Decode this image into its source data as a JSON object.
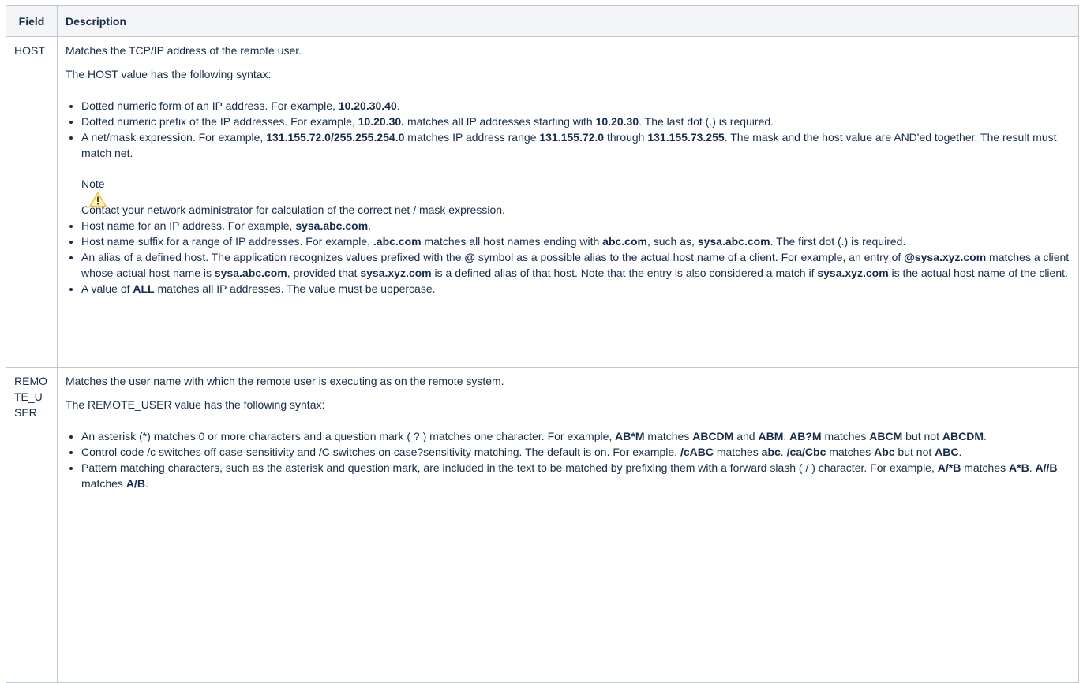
{
  "table": {
    "header": {
      "field": "Field",
      "description": "Description"
    },
    "rows": [
      {
        "field": "HOST",
        "intro": "Matches the TCP/IP address of the remote user.",
        "syntax": "The HOST value has the following syntax:",
        "items": [
          {
            "t1": "Dotted numeric form of an IP address. For example, ",
            "b1": "10.20.30.40",
            "t2": "."
          },
          {
            "t1": "Dotted numeric prefix of the IP addresses. For example, ",
            "b1": "10.20.30.",
            "t2": " matches all IP addresses starting with ",
            "b2": "10.20.30",
            "t3": ". The last dot (.) is required."
          },
          {
            "t1": "A net/mask expression. For example, ",
            "b1": "131.155.72.0/255.255.254.0",
            "t2": " matches IP address range ",
            "b2": "131.155.72.0",
            "t3": " through ",
            "b3": "131.155.73.255",
            "t4": ". The mask and the host value are AND'ed together. The result must match net."
          },
          {
            "t1": "Host name for an IP address. For example, ",
            "b1": "sysa.abc.com",
            "t2": "."
          },
          {
            "t1": "Host name suffix for a range of IP addresses. For example, ",
            "b1": ".abc.com",
            "t2": " matches all host names ending with ",
            "b2": "abc.com",
            "t3": ", such as, ",
            "b3": "sysa.abc.com",
            "t4": ". The first dot (.) is required."
          },
          {
            "t1": "An alias of a defined host. The application recognizes values prefixed with the ",
            "b1": "@",
            "t2": " symbol as a possible alias to the actual host name of a client. For example, an entry of ",
            "b2": "@sysa.xyz.com",
            "t3": " matches a client whose actual host name is ",
            "b3": "sysa.abc.com",
            "t4": ", provided that ",
            "b4": "sysa.xyz.com",
            "t5": " is a defined alias of that host. Note that the entry is also considered a match if ",
            "b5": "sysa.xyz.com",
            "t6": " is the actual host name of the client."
          },
          {
            "t1": "A value of ",
            "b1": "ALL",
            "t2": " matches all IP addresses. The value must be uppercase."
          }
        ],
        "note": {
          "title": "Note",
          "icon": "warning-icon",
          "body": "Contact your network administrator for calculation of the correct net / mask expression."
        }
      },
      {
        "field": "REMOTE_USER",
        "intro": "Matches the user name with which the remote user is executing as on the remote system.",
        "syntax": "The REMOTE_USER value has the following syntax:",
        "items": [
          {
            "t1": "An asterisk (*) matches 0 or more characters and a question mark ( ? ) matches one character. For example, ",
            "b1": "AB*M",
            "t2": " matches ",
            "b2": "ABCDM",
            "t3": " and ",
            "b3": "ABM",
            "t4": ". ",
            "b4": "AB?M",
            "t5": " matches ",
            "b5": "ABCM",
            "t6": " but not ",
            "b6": "ABCDM",
            "t7": "."
          },
          {
            "t1": "Control code /c switches off case-sensitivity and /C switches on case?sensitivity matching. The default is on. For example, ",
            "b1": "/cABC",
            "t2": " matches ",
            "b2": "abc",
            "t3": ". ",
            "b3": "/ca/Cbc",
            "t4": " matches ",
            "b4": "Abc",
            "t5": " but not ",
            "b5": "ABC",
            "t6": "."
          },
          {
            "t1": "Pattern matching characters, such as the asterisk and question mark, are included in the text to be matched by prefixing them with a forward slash ( / ) character. For example, ",
            "b1": "A/*B",
            "t2": " matches ",
            "b2": "A*B",
            "t3": ". ",
            "b3": "A//B",
            "t4": " matches ",
            "b4": "A/B",
            "t5": "."
          }
        ]
      }
    ]
  }
}
